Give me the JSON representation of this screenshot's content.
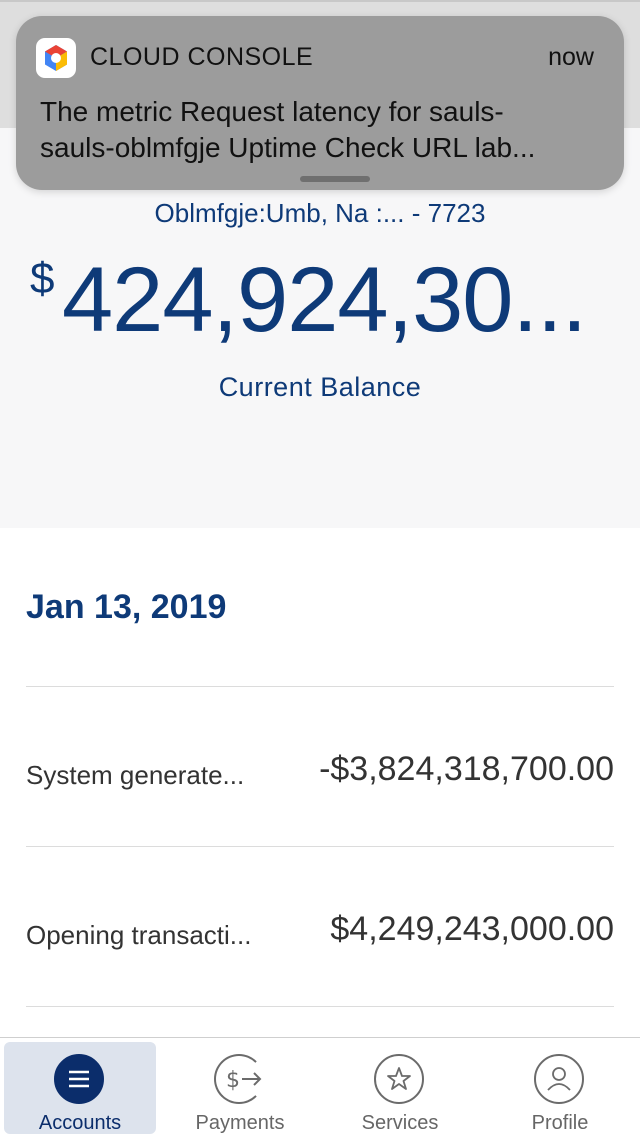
{
  "notification": {
    "app_name": "CLOUD CONSOLE",
    "time": "now",
    "line1": "The metric Request latency for sauls-",
    "line2": "sauls-oblmfgje Uptime Check URL lab...",
    "icon": "cloud-console-logo"
  },
  "account": {
    "name": "Oblmfgje:Umb, Na :... - 7723",
    "currency_symbol": "$",
    "balance": "424,924,30...",
    "balance_label": "Current Balance"
  },
  "transactions": {
    "date": "Jan 13, 2019",
    "items": [
      {
        "description": "System generate...",
        "amount": "-$3,824,318,700.00"
      },
      {
        "description": "Opening transacti...",
        "amount": "$4,249,243,000.00"
      }
    ]
  },
  "tabbar": {
    "items": [
      {
        "label": "Accounts",
        "icon": "menu-icon",
        "active": true
      },
      {
        "label": "Payments",
        "icon": "payments-icon",
        "active": false
      },
      {
        "label": "Services",
        "icon": "star-icon",
        "active": false
      },
      {
        "label": "Profile",
        "icon": "profile-icon",
        "active": false
      }
    ]
  },
  "colors": {
    "brand_navy": "#0e3a78",
    "active_tab_bg": "#dde3ed",
    "notification_bg": "#9c9c9c"
  }
}
